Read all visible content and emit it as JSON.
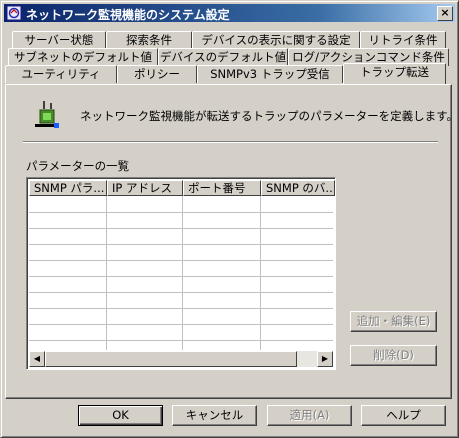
{
  "window": {
    "title": "ネットワーク監視機能のシステム設定",
    "close": "×"
  },
  "tabs": {
    "row1": [
      "サーバー状態",
      "探索条件",
      "デバイスの表示に関する設定",
      "リトライ条件"
    ],
    "row2": [
      "サブネットのデフォルト値",
      "デバイスのデフォルト値",
      "ログ/アクションコマンド条件"
    ],
    "row3": [
      "ユーティリティ",
      "ポリシー",
      "SNMPv3 トラップ受信",
      "トラップ転送"
    ],
    "active": "トラップ転送"
  },
  "panel": {
    "description": "ネットワーク監視機能が転送するトラップのパラメーターを定義します。",
    "list_label": "パラメーターの一覧",
    "columns": [
      "SNMP パラ...",
      "IP アドレス",
      "ポート番号",
      "SNMP のバ..."
    ],
    "rows": [],
    "add_edit_button": "追加・編集(E)",
    "delete_button": "削除(D)"
  },
  "footer": {
    "ok": "OK",
    "cancel": "キャンセル",
    "apply": "適用(A)",
    "help": "ヘルプ"
  },
  "colors": {
    "title_start": "#0a246a",
    "title_end": "#a6caf0",
    "face": "#d4d0c8"
  },
  "icons": [
    "app-icon",
    "close-icon",
    "trap-forward-icon",
    "scroll-left-icon",
    "scroll-right-icon"
  ]
}
